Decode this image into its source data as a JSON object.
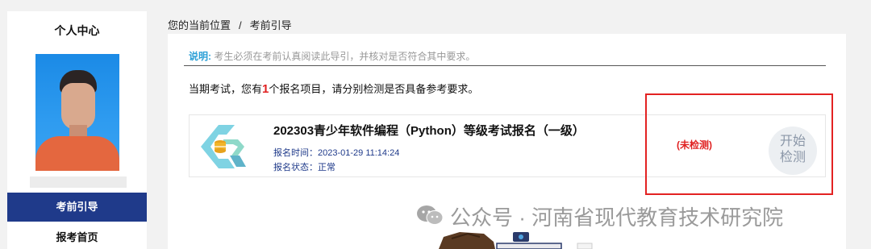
{
  "sidebar": {
    "title": "个人中心",
    "active_item": "考前引导",
    "items": [
      "报考首页"
    ]
  },
  "breadcrumb": {
    "prefix": "您的当前位置",
    "separator": "/",
    "current": "考前引导"
  },
  "notice": {
    "label": "说明:",
    "text": "考生必须在考前认真阅读此导引，并核对是否符合其中要求。"
  },
  "summary": {
    "before": "当期考试，您有",
    "count": "1",
    "after": "个报名项目，请分别检测是否具备参考要求。"
  },
  "exam": {
    "title": "202303青少年软件编程（Python）等级考试报名（一级）",
    "reg_time_label": "报名时间：",
    "reg_time": "2023-01-29 11:14:24",
    "reg_status_label": "报名状态：",
    "reg_status": "正常",
    "check_status": "(未检测)",
    "start_button_line1": "开始",
    "start_button_line2": "检测"
  },
  "watermark": {
    "text": "公众号 · 河南省现代教育技术研究院"
  },
  "colors": {
    "sidebar_active_bg": "#1f3a8a",
    "notice_label": "#2a9fd6",
    "status_red": "#e02020",
    "highlight_border": "#e32222"
  }
}
